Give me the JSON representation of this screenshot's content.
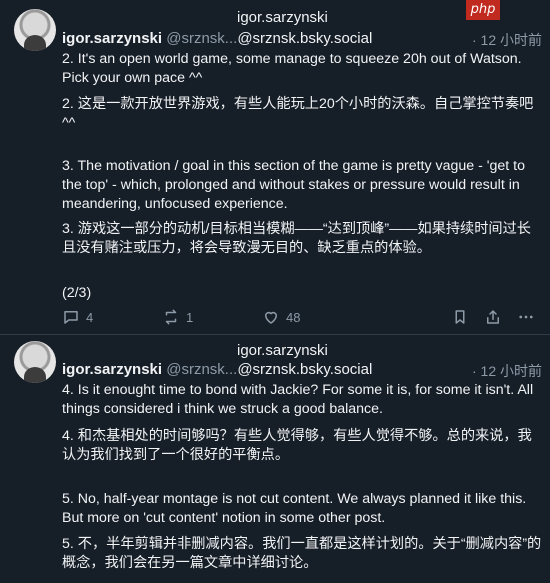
{
  "posts": [
    {
      "top_handle": "igor.sarzynski",
      "name": "igor.sarzynski",
      "handle_muted": "@srznsk...",
      "handle_rest": "@srznsk.bsky.social",
      "time": "· 12 小时前",
      "paragraphs": [
        "2. It's an open world game, some manage to squeeze 20h out of Watson. Pick your own pace ^^",
        "2. 这是一款开放世界游戏，有些人能玩上20个小时的沃森。自己掌控节奏吧^^",
        "3. The motivation / goal in this section of the game is pretty vague - 'get to the top' - which, prolonged and without stakes or pressure would result in meandering, unfocused experience.",
        "3. 游戏这一部分的动机/目标相当模糊——“达到顶峰”——如果持续时间过长且没有赌注或压力，将会导致漫无目的、缺乏重点的体验。",
        "(2/3)"
      ],
      "actions": {
        "replies": "4",
        "reposts": "1",
        "likes": "48"
      }
    },
    {
      "top_handle": "igor.sarzynski",
      "name": "igor.sarzynski",
      "handle_muted": "@srznsk...",
      "handle_rest": "@srznsk.bsky.social",
      "time": "· 12 小时前",
      "paragraphs": [
        "4. Is it enought time to bond with Jackie? For some it is, for some it isn't. All things considered i think we struck a good balance.",
        "4. 和杰基相处的时间够吗？有些人觉得够，有些人觉得不够。总的来说，我认为我们找到了一个很好的平衡点。",
        "5. No, half-year montage is not cut content. We always planned it like this. But more on 'cut content' notion in some other post.",
        "5. 不，半年剪辑并非删减内容。我们一直都是这样计划的。关于“删减内容”的概念，我们会在另一篇文章中详细讨论。"
      ]
    }
  ],
  "badge": "php"
}
